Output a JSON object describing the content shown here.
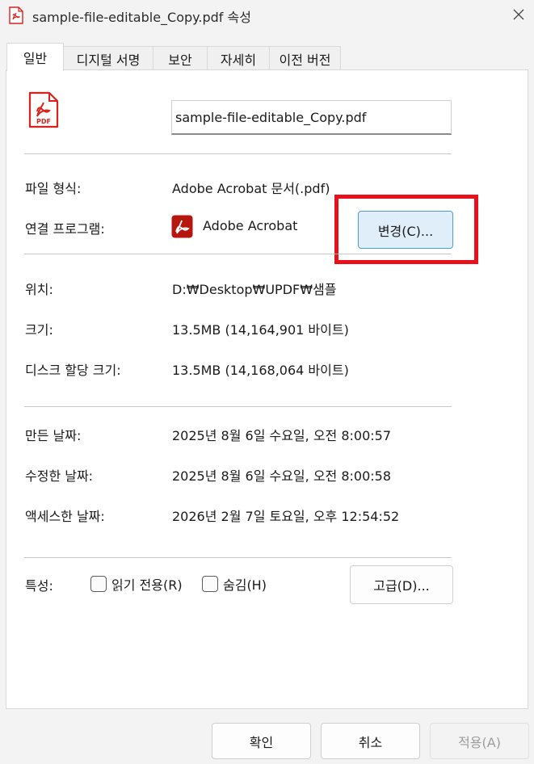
{
  "window": {
    "title": "sample-file-editable_Copy.pdf 속성"
  },
  "tabs": [
    {
      "label": "일반",
      "active": true
    },
    {
      "label": "디지털 서명",
      "active": false
    },
    {
      "label": "보안",
      "active": false
    },
    {
      "label": "자세히",
      "active": false
    },
    {
      "label": "이전 버전",
      "active": false
    }
  ],
  "general": {
    "file_icon_text": "PDF",
    "file_name": "sample-file-editable_Copy.pdf",
    "file_type_label": "파일 형식:",
    "file_type_value": "Adobe Acrobat 문서(.pdf)",
    "opens_with_label": "연결 프로그램:",
    "opens_with_app": "Adobe Acrobat",
    "change_button": "변경(C)...",
    "location_label": "위치:",
    "location_value": "D:₩Desktop₩UPDF₩샘플",
    "size_label": "크기:",
    "size_value": "13.5MB (14,164,901 바이트)",
    "size_on_disk_label": "디스크 할당 크기:",
    "size_on_disk_value": "13.5MB (14,168,064 바이트)",
    "created_label": "만든 날짜:",
    "created_value": "2025년 8월 6일 수요일, 오전 8:00:57",
    "modified_label": "수정한 날짜:",
    "modified_value": "2025년 8월 6일 수요일, 오전 8:00:58",
    "accessed_label": "액세스한 날짜:",
    "accessed_value": "2026년 2월 7일 토요일, 오후 12:54:52",
    "attributes_label": "특성:",
    "readonly_label": "읽기 전용(R)",
    "readonly_checked": false,
    "hidden_label": "숨김(H)",
    "hidden_checked": false,
    "advanced_button": "고급(D)..."
  },
  "footer": {
    "ok": "확인",
    "cancel": "취소",
    "apply": "적용(A)"
  },
  "colors": {
    "pdf_red": "#d9221c",
    "highlight": "#e8101a",
    "accent_button_bg": "#e0eef9",
    "accent_button_border": "#4c9ed8"
  }
}
